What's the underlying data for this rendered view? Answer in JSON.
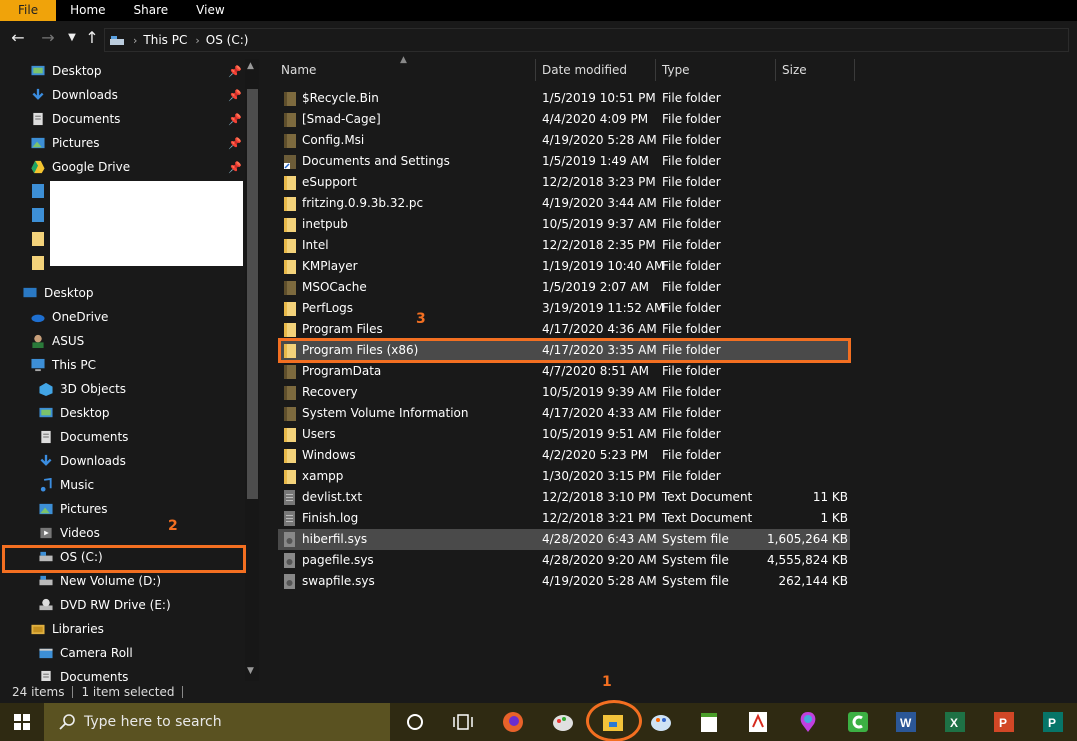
{
  "ribbon": {
    "tabs": [
      "File",
      "Home",
      "Share",
      "View"
    ]
  },
  "address": {
    "crumbs": [
      "This PC",
      "OS (C:)"
    ]
  },
  "nav": {
    "quick_access": [
      {
        "label": "Desktop",
        "icon": "desktop-icon"
      },
      {
        "label": "Downloads",
        "icon": "download-arrow-icon"
      },
      {
        "label": "Documents",
        "icon": "documents-icon"
      },
      {
        "label": "Pictures",
        "icon": "pictures-icon"
      },
      {
        "label": "Google Drive",
        "icon": "google-drive-icon"
      }
    ],
    "tree": [
      {
        "label": "Desktop",
        "icon": "desktop-folder-icon"
      },
      {
        "label": "OneDrive",
        "icon": "onedrive-icon"
      },
      {
        "label": "ASUS",
        "icon": "user-icon"
      },
      {
        "label": "This PC",
        "icon": "computer-icon"
      },
      {
        "label": "3D Objects",
        "icon": "cube-icon"
      },
      {
        "label": "Desktop",
        "icon": "desktop-icon"
      },
      {
        "label": "Documents",
        "icon": "documents-icon"
      },
      {
        "label": "Downloads",
        "icon": "download-arrow-icon"
      },
      {
        "label": "Music",
        "icon": "music-icon"
      },
      {
        "label": "Pictures",
        "icon": "pictures-icon"
      },
      {
        "label": "Videos",
        "icon": "videos-icon"
      },
      {
        "label": "OS (C:)",
        "icon": "drive-icon"
      },
      {
        "label": "New Volume (D:)",
        "icon": "drive-icon"
      },
      {
        "label": "DVD RW Drive (E:)",
        "icon": "dvd-drive-icon"
      },
      {
        "label": "Libraries",
        "icon": "libraries-icon"
      },
      {
        "label": "Camera Roll",
        "icon": "camera-roll-icon"
      },
      {
        "label": "Documents",
        "icon": "documents-icon"
      }
    ]
  },
  "columns": {
    "name": "Name",
    "date": "Date modified",
    "type": "Type",
    "size": "Size"
  },
  "files": [
    {
      "name": "$Recycle.Bin",
      "date": "1/5/2019 10:51 PM",
      "type": "File folder",
      "size": "",
      "kind": "system-folder"
    },
    {
      "name": "[Smad-Cage]",
      "date": "4/4/2020 4:09 PM",
      "type": "File folder",
      "size": "",
      "kind": "system-folder"
    },
    {
      "name": "Config.Msi",
      "date": "4/19/2020 5:28 AM",
      "type": "File folder",
      "size": "",
      "kind": "system-folder"
    },
    {
      "name": "Documents and Settings",
      "date": "1/5/2019 1:49 AM",
      "type": "File folder",
      "size": "",
      "kind": "shortcut-folder"
    },
    {
      "name": "eSupport",
      "date": "12/2/2018 3:23 PM",
      "type": "File folder",
      "size": "",
      "kind": "folder"
    },
    {
      "name": "fritzing.0.9.3b.32.pc",
      "date": "4/19/2020 3:44 AM",
      "type": "File folder",
      "size": "",
      "kind": "folder"
    },
    {
      "name": "inetpub",
      "date": "10/5/2019 9:37 AM",
      "type": "File folder",
      "size": "",
      "kind": "folder"
    },
    {
      "name": "Intel",
      "date": "12/2/2018 2:35 PM",
      "type": "File folder",
      "size": "",
      "kind": "folder"
    },
    {
      "name": "KMPlayer",
      "date": "1/19/2019 10:40 AM",
      "type": "File folder",
      "size": "",
      "kind": "folder"
    },
    {
      "name": "MSOCache",
      "date": "1/5/2019 2:07 AM",
      "type": "File folder",
      "size": "",
      "kind": "system-folder"
    },
    {
      "name": "PerfLogs",
      "date": "3/19/2019 11:52 AM",
      "type": "File folder",
      "size": "",
      "kind": "folder"
    },
    {
      "name": "Program Files",
      "date": "4/17/2020 4:36 AM",
      "type": "File folder",
      "size": "",
      "kind": "folder"
    },
    {
      "name": "Program Files (x86)",
      "date": "4/17/2020 3:35 AM",
      "type": "File folder",
      "size": "",
      "kind": "folder"
    },
    {
      "name": "ProgramData",
      "date": "4/7/2020 8:51 AM",
      "type": "File folder",
      "size": "",
      "kind": "system-folder"
    },
    {
      "name": "Recovery",
      "date": "10/5/2019 9:39 AM",
      "type": "File folder",
      "size": "",
      "kind": "system-folder"
    },
    {
      "name": "System Volume Information",
      "date": "4/17/2020 4:33 AM",
      "type": "File folder",
      "size": "",
      "kind": "system-folder"
    },
    {
      "name": "Users",
      "date": "10/5/2019 9:51 AM",
      "type": "File folder",
      "size": "",
      "kind": "folder"
    },
    {
      "name": "Windows",
      "date": "4/2/2020 5:23 PM",
      "type": "File folder",
      "size": "",
      "kind": "folder"
    },
    {
      "name": "xampp",
      "date": "1/30/2020 3:15 PM",
      "type": "File folder",
      "size": "",
      "kind": "folder"
    },
    {
      "name": "devlist.txt",
      "date": "12/2/2018 3:10 PM",
      "type": "Text Document",
      "size": "11 KB",
      "kind": "text-file"
    },
    {
      "name": "Finish.log",
      "date": "12/2/2018 3:21 PM",
      "type": "Text Document",
      "size": "1 KB",
      "kind": "text-file"
    },
    {
      "name": "hiberfil.sys",
      "date": "4/28/2020 6:43 AM",
      "type": "System file",
      "size": "1,605,264 KB",
      "kind": "sys-file"
    },
    {
      "name": "pagefile.sys",
      "date": "4/28/2020 9:20 AM",
      "type": "System file",
      "size": "4,555,824 KB",
      "kind": "sys-file"
    },
    {
      "name": "swapfile.sys",
      "date": "4/19/2020 5:28 AM",
      "type": "System file",
      "size": "262,144 KB",
      "kind": "sys-file"
    }
  ],
  "selected_file_index": 12,
  "hovered_file_index": 21,
  "annotations": {
    "step1": "1",
    "step2": "2",
    "step3": "3"
  },
  "status": {
    "item_count": "24 items",
    "selection": "1 item selected"
  },
  "taskbar": {
    "search_placeholder": "Type here to search",
    "apps": [
      "cortana-circle-icon",
      "task-view-icon",
      "firefox-icon",
      "paint-icon",
      "file-explorer-icon",
      "paint-palette-icon",
      "notepad-icon",
      "acrobat-icon",
      "vivaldi-icon",
      "camtasia-icon",
      "word-icon",
      "excel-icon",
      "powerpoint-icon",
      "publisher-icon"
    ]
  },
  "colors": {
    "accent": "#f36f21",
    "file_tab": "#f0a30a",
    "taskbar": "#2f2a12",
    "search": "#5a5221",
    "folder": "#f3d27a",
    "system_folder": "#7d6a3e"
  }
}
